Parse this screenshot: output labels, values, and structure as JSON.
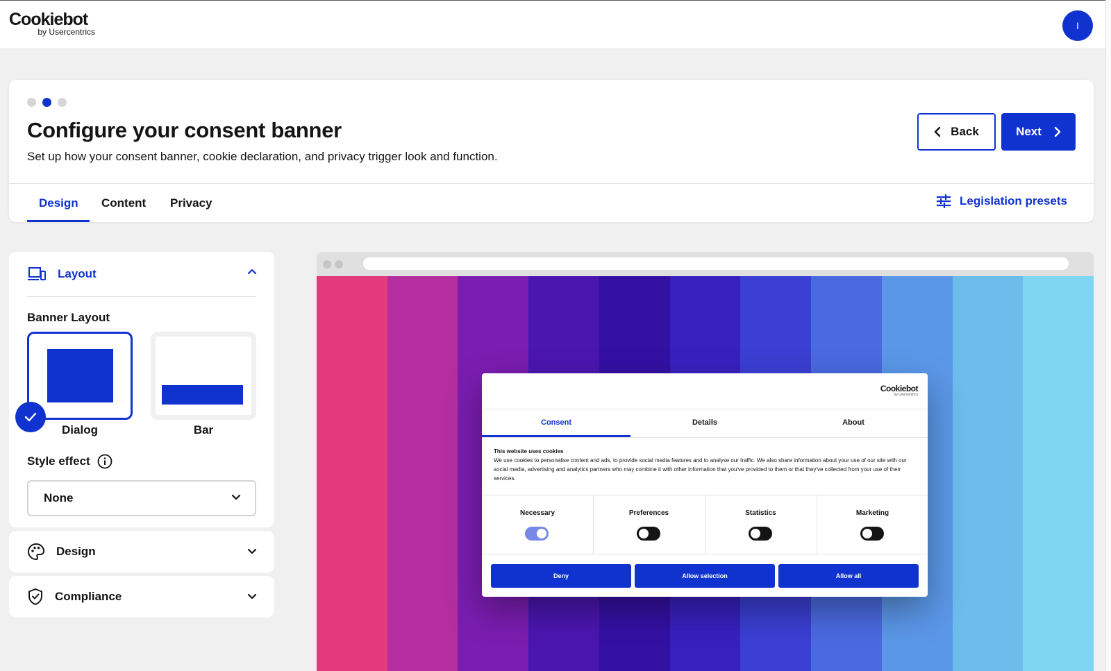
{
  "header": {
    "logo_main": "Cookiebot",
    "logo_sub": "by Usercentrics",
    "avatar_initial": "I"
  },
  "wizard": {
    "steps_total": 3,
    "current_step": 2,
    "title": "Configure your consent banner",
    "subtitle": "Set up how your consent banner, cookie declaration, and privacy trigger look and function.",
    "back_label": "Back",
    "next_label": "Next",
    "tabs": [
      {
        "label": "Design",
        "active": true
      },
      {
        "label": "Content",
        "active": false
      },
      {
        "label": "Privacy",
        "active": false
      }
    ],
    "presets_label": "Legislation presets"
  },
  "sidebar": {
    "layout": {
      "title": "Layout",
      "expanded": true,
      "banner_layout_label": "Banner Layout",
      "options": [
        {
          "label": "Dialog",
          "selected": true
        },
        {
          "label": "Bar",
          "selected": false
        }
      ],
      "style_effect_label": "Style effect",
      "style_effect_value": "None"
    },
    "design": {
      "title": "Design",
      "expanded": false
    },
    "compliance": {
      "title": "Compliance",
      "expanded": false
    }
  },
  "preview": {
    "background_stripes": [
      "#e23a7c",
      "#b42ea0",
      "#7a1db0",
      "#4a16b0",
      "#3410a3",
      "#3820bf",
      "#3b3fd3",
      "#4a6ae0",
      "#5b97e8",
      "#6cbdeb",
      "#7fd6f2"
    ],
    "banner": {
      "logo_main": "Cookiebot",
      "logo_sub": "by Usercentrics",
      "tabs": [
        {
          "label": "Consent",
          "active": true
        },
        {
          "label": "Details",
          "active": false
        },
        {
          "label": "About",
          "active": false
        }
      ],
      "heading": "This website uses cookies",
      "body": "We use cookies to personalise content and ads, to provide social media features and to analyse our traffic. We also share information about your use of our site with our social media, advertising and analytics partners who may combine it with other information that you've provided to them or that they've collected from your use of their services.",
      "categories": [
        {
          "label": "Necessary",
          "enabled": true
        },
        {
          "label": "Preferences",
          "enabled": false
        },
        {
          "label": "Statistics",
          "enabled": false
        },
        {
          "label": "Marketing",
          "enabled": false
        }
      ],
      "buttons": [
        "Deny",
        "Allow selection",
        "Allow all"
      ]
    }
  },
  "colors": {
    "accent": "#1032cf",
    "background": "#f0f0f0"
  }
}
